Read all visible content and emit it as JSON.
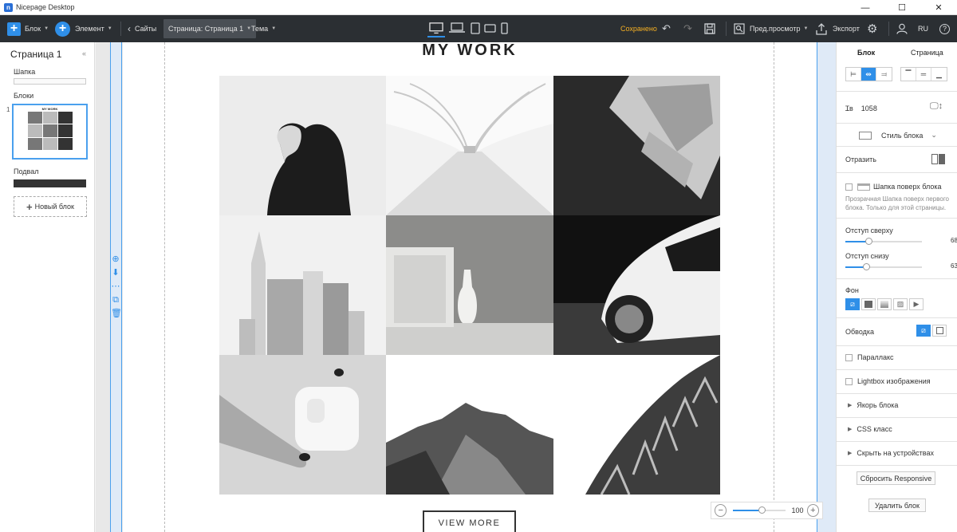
{
  "window": {
    "app_title": "Nicepage Desktop",
    "minimize": "—",
    "maximize": "☐",
    "close": "✕"
  },
  "toolbar": {
    "block_label": "Блок",
    "element_label": "Элемент",
    "sites_label": "Сайты",
    "page_select": "Страница: Страница 1",
    "theme_label": "Тема",
    "saved_status": "Сохранено",
    "preview_label": "Пред.просмотр",
    "export_label": "Экспорт",
    "lang": "RU"
  },
  "left_panel": {
    "page_title": "Страница 1",
    "header_label": "Шапка",
    "blocks_label": "Блоки",
    "block_number": "1",
    "block_thumb_title": "MY WORK",
    "footer_label": "Подвал",
    "new_block_label": "Новый блок"
  },
  "canvas": {
    "section_title": "MY WORK",
    "view_more_label": "VIEW MORE",
    "zoom_value": "100",
    "zoom_fraction": 0.55
  },
  "right_panel": {
    "tab_block": "Блок",
    "tab_page": "Страница",
    "width_value": "1058",
    "block_style_label": "Стиль блока",
    "flip_label": "Отразить",
    "header_over_label": "Шапка поверх блока",
    "header_over_hint": "Прозрачная Шапка поверх первого блока. Только для этой страницы.",
    "padding_top_label": "Отступ сверху",
    "padding_top_value": "68",
    "padding_top_fraction": 0.3,
    "padding_bottom_label": "Отступ снизу",
    "padding_bottom_value": "63",
    "padding_bottom_fraction": 0.27,
    "background_label": "Фон",
    "border_label": "Обводка",
    "parallax_label": "Параллакс",
    "lightbox_label": "Lightbox изображения",
    "anchor_label": "Якорь блока",
    "css_class_label": "CSS класс",
    "hide_devices_label": "Скрыть на устройствах",
    "reset_responsive_label": "Сбросить Responsive",
    "delete_block_label": "Удалить блок"
  },
  "colors": {
    "accent": "#2f8fe8",
    "toolbar_bg": "#2b2f33",
    "saved": "#f5b023"
  }
}
